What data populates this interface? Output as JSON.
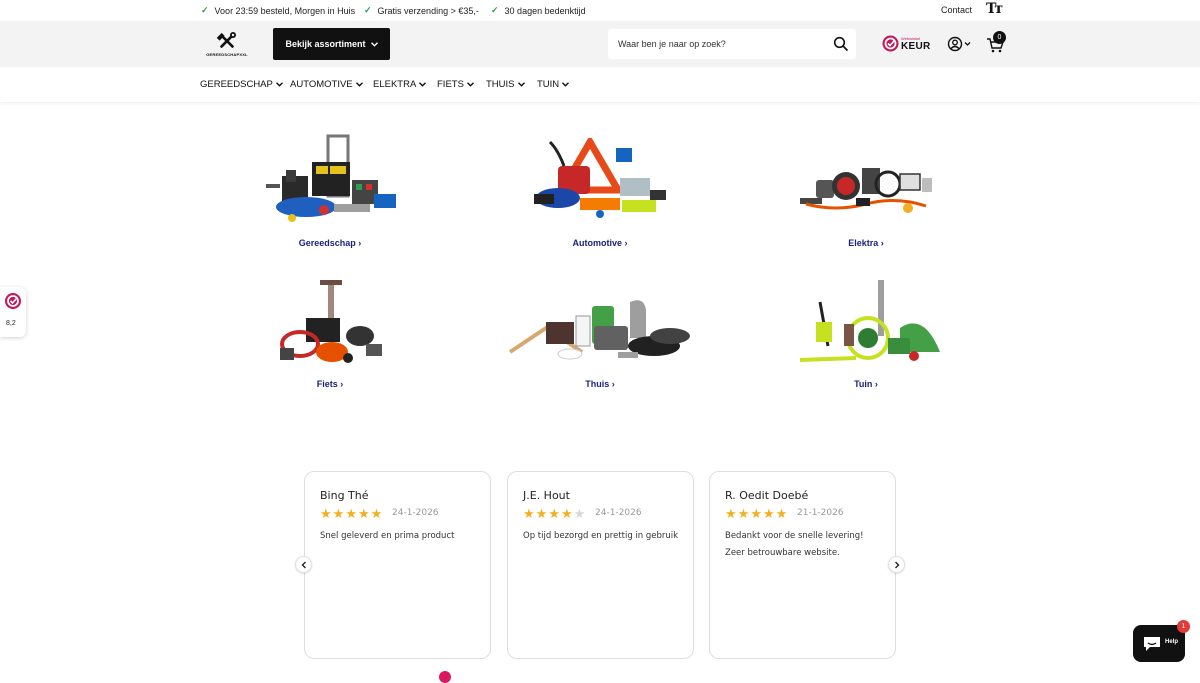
{
  "topbar": {
    "usps": [
      "Voor 23:59 besteld, Morgen in Huis",
      "Gratis verzending > €35,-",
      "30 dagen bedenktijd"
    ],
    "contact": "Contact",
    "text_size_icon": "Tт"
  },
  "header": {
    "logo_text": "GEREEDSCHAPXXL",
    "browse_label": "Bekijk assortiment",
    "search_placeholder": "Waar ben je naar op zoek?",
    "keur_small": "Webwinkel",
    "keur_big": "KEUR",
    "cart_count": "0"
  },
  "nav": {
    "items": [
      "GEREEDSCHAP",
      "AUTOMOTIVE",
      "ELEKTRA",
      "FIETS",
      "THUIS",
      "TUIN"
    ]
  },
  "categories": [
    {
      "label": "Gereedschap ›",
      "image": "tools-collection"
    },
    {
      "label": "Automotive ›",
      "image": "automotive-collection"
    },
    {
      "label": "Elektra ›",
      "image": "electrical-collection"
    },
    {
      "label": "Fiets ›",
      "image": "bike-collection"
    },
    {
      "label": "Thuis ›",
      "image": "home-collection"
    },
    {
      "label": "Tuin ›",
      "image": "garden-collection"
    }
  ],
  "reviews": [
    {
      "name": "Bing Thé",
      "rating": 5,
      "date": "24-1-2026",
      "text": "Snel geleverd en prima product"
    },
    {
      "name": "J.E. Hout",
      "rating": 4,
      "date": "24-1-2026",
      "text": "Op tijd bezorgd en prettig in gebruik"
    },
    {
      "name": "R. Oedit Doebé",
      "rating": 5,
      "date": "21-1-2026",
      "text": "Bedankt voor de snelle levering! Zeer betrouwbare website."
    }
  ],
  "side_badge": {
    "score": "8,2"
  },
  "chat": {
    "label": "Help",
    "badge": "1"
  },
  "colors": {
    "accent_navy": "#1a237e",
    "star": "#f2b01e",
    "keur_pink": "#c2185b",
    "check_green": "#2e9e4c"
  }
}
